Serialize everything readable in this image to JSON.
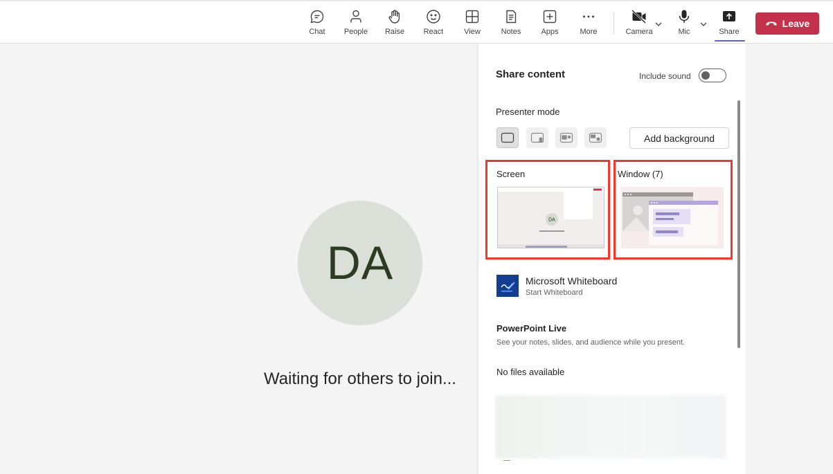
{
  "toolbar": {
    "chat": "Chat",
    "people": "People",
    "raise": "Raise",
    "react": "React",
    "view": "View",
    "notes": "Notes",
    "apps": "Apps",
    "more": "More",
    "camera": "Camera",
    "mic": "Mic",
    "share": "Share",
    "leave": "Leave"
  },
  "stage": {
    "avatar_initials": "DA",
    "waiting_text": "Waiting for others to join..."
  },
  "share_panel": {
    "title": "Share content",
    "include_sound_label": "Include sound",
    "include_sound_on": false,
    "presenter_mode_label": "Presenter mode",
    "add_background_label": "Add background",
    "screen_label": "Screen",
    "window_label": "Window (7)",
    "screen_thumb_initials": "DA",
    "whiteboard_title": "Microsoft Whiteboard",
    "whiteboard_sub": "Start Whiteboard",
    "powerpoint_title": "PowerPoint Live",
    "powerpoint_sub": "See your notes, slides, and audience while you present.",
    "no_files": "No files available"
  },
  "colors": {
    "leave_red": "#c4314b",
    "accent_purple": "#5b5fc7",
    "highlight_red": "#f1382d",
    "avatar_bg": "#dadfd7"
  }
}
